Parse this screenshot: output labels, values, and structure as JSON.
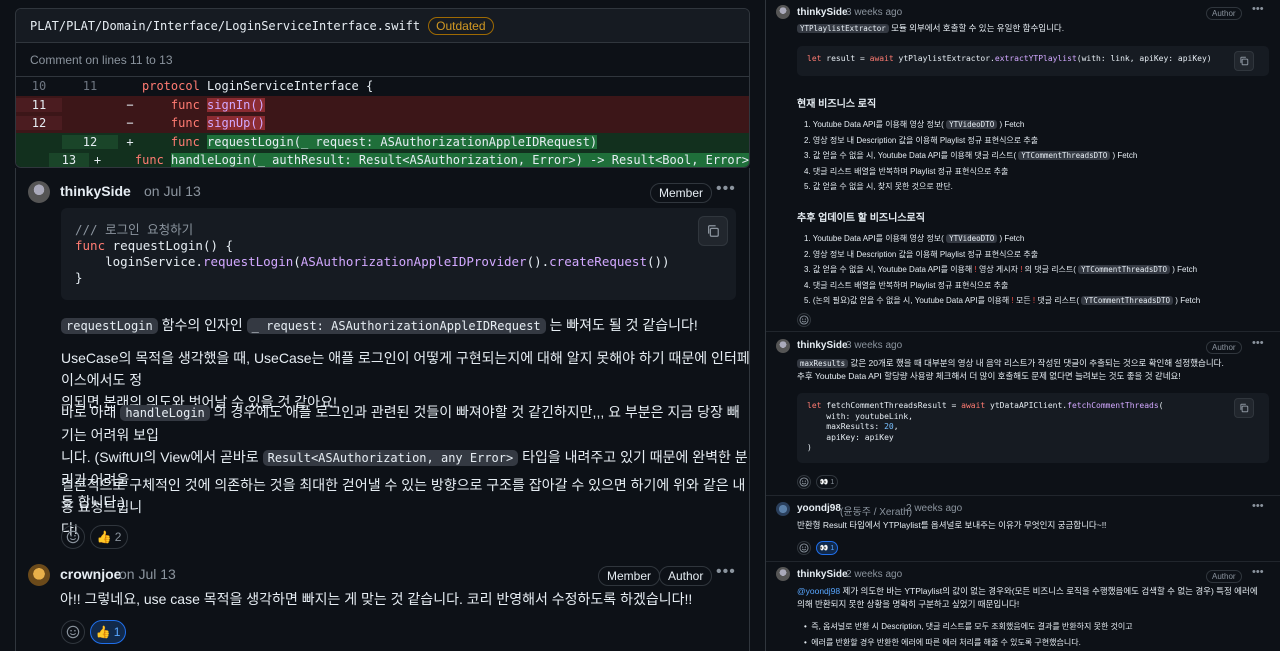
{
  "left": {
    "file_path": "PLAT/PLAT/Domain/Interface/LoginServiceInterface.swift",
    "outdated_badge": "Outdated",
    "comment_lines": "Comment on lines 11 to 13",
    "diff": [
      {
        "old": "10",
        "new": "11",
        "sign": "",
        "pre": "protocol ",
        "hl": "",
        "post": "LoginServiceInterface {",
        "type": "ctx"
      },
      {
        "old": "11",
        "new": "",
        "sign": "−",
        "pre": "    func ",
        "hl": "signIn()",
        "post": "",
        "type": "del"
      },
      {
        "old": "12",
        "new": "",
        "sign": "−",
        "pre": "    func ",
        "hl": "signUp()",
        "post": "",
        "type": "del"
      },
      {
        "old": "",
        "new": "12",
        "sign": "+",
        "pre": "    func ",
        "hl": "requestLogin(_ request: ASAuthorizationAppleIDRequest)",
        "post": "",
        "type": "add"
      },
      {
        "old": "",
        "new": "13",
        "sign": "+",
        "pre": "    func ",
        "hl": "handleLogin(_ authResult: Result<ASAuthorization, Error>) -> Result<Bool, Error>",
        "post": "",
        "type": "add"
      }
    ],
    "comment1": {
      "author": "thinkySide",
      "date": "on Jul 13",
      "badge": "Member",
      "code_line1": "/// 로그인 요청하기",
      "code_line2_kw": "func",
      "code_line2": " requestLogin() {",
      "code_line3_a": "    loginService.",
      "code_line3_fn": "requestLogin",
      "code_line3_b": "(",
      "code_line3_fn2": "ASAuthorizationAppleIDProvider",
      "code_line3_c": "().",
      "code_line3_fn3": "createRequest",
      "code_line3_d": "())",
      "code_line4": "}",
      "p1_code1": "requestLogin",
      "p1_text1": " 함수의 인자인 ",
      "p1_code2": "_ request: ASAuthorizationAppleIDRequest",
      "p1_text2": " 는 빠져도 될 것 같습니다!",
      "p2_line1": "UseCase의 목적을 생각했을 때, UseCase는 애플 로그인이 어떻게 구현되는지에 대해 알지 못해야 하기 때문에 인터페이스에서도 정",
      "p2_line2": "의되면 본래의 의도와 벗어날 수 있을 것 같아요!",
      "p3_text1": "바로 아래 ",
      "p3_code1": "handleLogin",
      "p3_text2": " 의 경우에도 애플 로그인과 관련된 것들이 빠져야할 것 같긴하지만,,, 요 부분은 지금 당장 빼기는 어려워 보입",
      "p3_text3": "니다. (SwiftUI의 View에서 곧바로 ",
      "p3_code2": "Result<ASAuthorization, any Error>",
      "p3_text4": " 타입을 내려주고 있기 때문에 완벽한 분리가 어려울",
      "p3_text5": "듯 합니다.)",
      "p4_line1": "결론적으로 구체적인 것에 의존하는 것을 최대한 걷어낼 수 있는 방향으로 구조를 잡아갈 수 있으면 하기에 위와 같은 내용 요청드립니",
      "p4_line2": "다!",
      "reaction_count": "2"
    },
    "comment2": {
      "author": "crownjoe",
      "date": "on Jul 13",
      "badge1": "Member",
      "badge2": "Author",
      "text": "아!! 그렇네요, use case 목적을 생각하면 빠지는 게 맞는 것 같습니다. 코리 반영해서 수정하도록 하겠습니다!!",
      "reaction_count": "1"
    }
  },
  "right": {
    "c1": {
      "author": "thinkySide",
      "date": "3 weeks ago",
      "badge": "Author",
      "text_code": "YTPlaylistExtractor",
      "text": " 모듈 외부에서 호출할 수 있는 유일한 함수입니다.",
      "code_kw1": "let",
      "code_a": " result = ",
      "code_kw2": "await",
      "code_b": " ytPlaylistExtractor.",
      "code_fn": "extractYTPlaylist",
      "code_c": "(with: link, apiKey: apiKey)",
      "h1": "현재 비즈니스 로직",
      "list1": [
        {
          "text": "1. Youtube Data API를 이용해 영상 정보( ",
          "code": "YTVideoDTO",
          "tail": " ) Fetch"
        },
        {
          "text": "2. 영상 정보 내 Description 값을 이용해 Playlist 정규 표현식으로 추출",
          "code": "",
          "tail": ""
        },
        {
          "text": "3. 값 얻을 수 없을 시, Youtube Data API를 이용해 댓글 리스트( ",
          "code": "YTCommentThreadsDTO",
          "tail": " ) Fetch"
        },
        {
          "text": "4. 댓글 리스트 배열을 반복하며 Playlist 정규 표현식으로 추출",
          "code": "",
          "tail": ""
        },
        {
          "text": "5. 값 얻을 수 없을 시, 찾지 못한 것으로 판단.",
          "code": "",
          "tail": ""
        }
      ],
      "h2": "추후 업데이트 할 비즈니스로직",
      "list2_1": "1. Youtube Data API를 이용해 영상 정보( ",
      "list2_1_code": "YTVideoDTO",
      "list2_1_tail": " ) Fetch",
      "list2_2": "2. 영상 정보 내 Description 값을 이용해 Playlist 정규 표현식으로 추출",
      "list2_3a": "3. 값 얻을 수 없을 시, Youtube Data API를 이용해 ",
      "list2_3mark": "!",
      "list2_3b": " 영상 게시자 ",
      "list2_3c": " 의 댓글 리스트( ",
      "list2_3_code": "YTCommentThreadsDTO",
      "list2_3_tail": " ) Fetch",
      "list2_4": "4. 댓글 리스트 배열을 반복하며 Playlist 정규 표현식으로 추출",
      "list2_5a": "5. (논의 필요)값 얻을 수 없을 시, Youtube Data API를 이용해 ",
      "list2_5b": " 모든 ",
      "list2_5c": " 댓글 리스트( ",
      "list2_5_code": "YTCommentThreadsDTO",
      "list2_5_tail": " ) Fetch"
    },
    "c2": {
      "author": "thinkySide",
      "date": "3 weeks ago",
      "badge": "Author",
      "line1_code": "maxResults",
      "line1": " 값은 20개로 했을 때 대부분의 영상 내 음악 리스트가 작성된 댓글이 추출되는 것으로 확인해 설정했습니다.",
      "line2": "추후 Youtube Data API 할당량 사용량 체크해서 더 많이 호출해도 문제 없다면 늘려보는 것도 좋을 것 같네요!",
      "code1_kw": "let",
      "code1_a": " fetchCommentThreadsResult = ",
      "code1_kw2": "await",
      "code1_b": " ytDataAPIClient.",
      "code1_fn": "fetchCommentThreads",
      "code1_c": "(",
      "code2": "    with: youtubeLink,",
      "code3_a": "    maxResults: ",
      "code3_num": "20",
      "code3_b": ",",
      "code4": "    apiKey: apiKey",
      "code5": ")",
      "reaction_count": "1"
    },
    "c3": {
      "author": "yoondj98",
      "alias": "(윤동주 / Xerath)",
      "date": "2 weeks ago",
      "text": "반환형 Result 타입에서 YTPlaylist를 옵셔널로 보내주는 이유가 무엇인지 궁금합니다~!!",
      "reaction_count": "1"
    },
    "c4": {
      "author": "thinkySide",
      "date": "2 weeks ago",
      "badge": "Author",
      "mention": "@yoondj98",
      "line1": " 제가 의도한 바는 YTPlaylist의 값이 없는 경우와(모든 비즈니스 로직을 수행했음에도 검색할 수 없는 경우) 특정 에러에",
      "line2": "의해 반환되지 못한 상황을 명확히 구분하고 싶었기 때문입니다!",
      "bullet1": "즉, 옵셔널로 반환 시 Description, 댓글 리스트를 모두 조회했음에도 결과를 반환하지 못한 것이고",
      "bullet2": "에러를 반환할 경우 반환한 에러에 따른 에러 처리를 해줄 수 있도록 구현했습니다."
    }
  }
}
